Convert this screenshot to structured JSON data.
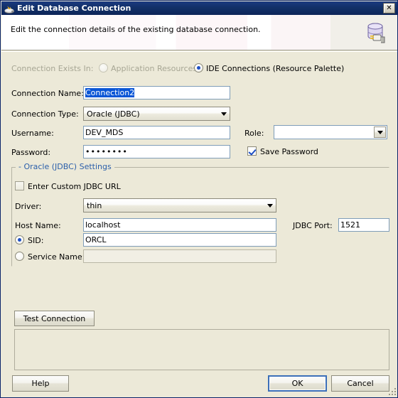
{
  "window": {
    "title": "Edit Database Connection",
    "title_icon": "jdeveloper-app-icon",
    "close_label": "✕"
  },
  "banner": {
    "description": "Edit the connection details of the existing database connection.",
    "icon": "database-connection-icon"
  },
  "form": {
    "connection_exists_in_label": "Connection Exists In:",
    "application_resources_label": "Application Resources",
    "ide_connections_label": "IDE Connections (Resource Palette)",
    "connection_name_label": "Connection Name:",
    "connection_name_value": "Connection2",
    "connection_type_label": "Connection Type:",
    "connection_type_value": "Oracle (JDBC)",
    "username_label": "Username:",
    "username_value": "DEV_MDS",
    "password_label": "Password:",
    "password_value": "••••••••",
    "role_label": "Role:",
    "role_value": "",
    "save_password_label": "Save Password"
  },
  "settings_group": {
    "title": "- Oracle (JDBC) Settings",
    "custom_url_label": "Enter Custom JDBC URL",
    "driver_label": "Driver:",
    "driver_value": "thin",
    "host_name_label": "Host Name:",
    "host_name_value": "localhost",
    "jdbc_port_label": "JDBC Port:",
    "jdbc_port_value": "1521",
    "sid_label": "SID:",
    "sid_value": "ORCL",
    "service_name_label": "Service Name:",
    "service_name_value": ""
  },
  "actions": {
    "test_connection_label": "Test Connection",
    "test_output_value": "",
    "help_label": "Help",
    "ok_label": "OK",
    "cancel_label": "Cancel"
  },
  "colors": {
    "titlebar_start": "#1b3a80",
    "titlebar_end": "#0d2559",
    "dialog_face": "#ece9d8",
    "group_title": "#2b5faa",
    "selection_blue": "#0a56d6",
    "accent_check": "#1d4fc4",
    "disabled_text": "#a7a694"
  }
}
